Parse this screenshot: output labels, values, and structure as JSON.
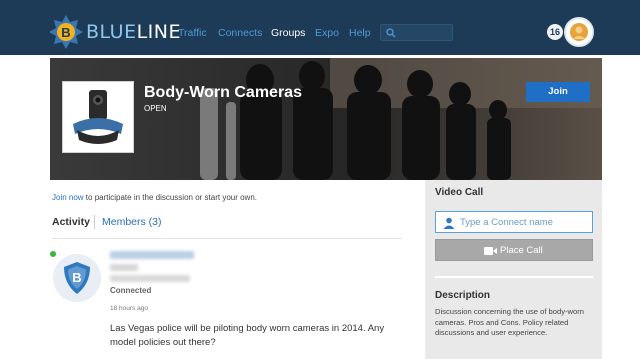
{
  "app": {
    "logo_text_a": "BLUE",
    "logo_text_b": "LINE"
  },
  "nav": {
    "items": [
      "Traffic",
      "Connects",
      "Groups",
      "Expo",
      "Help"
    ],
    "active": "Groups",
    "notification_count": "16"
  },
  "group": {
    "title": "Body-Worn Cameras",
    "status": "OPEN",
    "join_label": "Join"
  },
  "main": {
    "join_link": "Join now",
    "join_rest": " to participate in the discussion or start your own.",
    "tabs": {
      "activity": "Activity",
      "members": "Members (3)"
    },
    "post": {
      "status": "Connected",
      "time": "18 hours ago",
      "body": "Las Vegas police will be piloting body worn cameras in 2014. Any model policies out there?"
    }
  },
  "sidebar": {
    "video_call_title": "Video Call",
    "connect_placeholder": "Type a Connect name",
    "place_call_label": "Place Call",
    "description_title": "Description",
    "description_body": "Discussion concerning the use of body-worn cameras.  Pros and Cons.  Policy related discussions and user experience."
  },
  "colors": {
    "navbar": "#1d3a56",
    "accent": "#1f6fc6",
    "link": "#2a6fb6",
    "online": "#3ab53a"
  }
}
